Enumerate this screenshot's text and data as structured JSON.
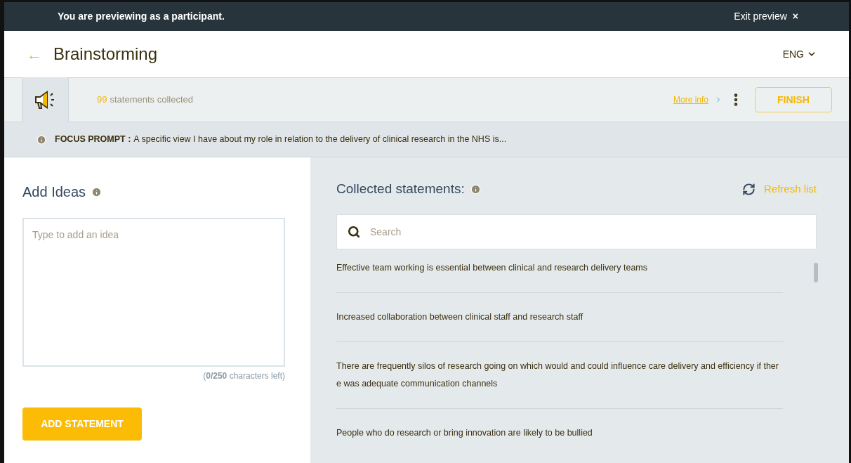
{
  "preview_bar": {
    "message": "You are previewing as a participant.",
    "exit_label": "Exit preview",
    "close_glyph": "×"
  },
  "header": {
    "back_glyph": "←",
    "title": "Brainstorming",
    "language": "ENG"
  },
  "toolbar": {
    "count": "99",
    "count_label": "statements collected",
    "more_info": "More info",
    "finish": "FINISH"
  },
  "focus_prompt": {
    "label": "FOCUS PROMPT :",
    "text": "A specific view I have about my role in relation to the delivery of clinical research in the NHS is..."
  },
  "add_ideas": {
    "title": "Add Ideas",
    "placeholder": "Type to add an idea",
    "counter": "(**0/250** characters left)",
    "button": "ADD STATEMENT"
  },
  "collected": {
    "title": "Collected statements:",
    "refresh": "Refresh list",
    "search_placeholder": "Search",
    "statements": [
      "Effective team working is essential between clinical and research delivery teams",
      "Increased collaboration between clinical staff and research staff",
      "There are frequently silos of research going on which would and could influence care delivery and efficiency if there was adequate communication channels",
      "People who do research or bring innovation are likely to be bullied"
    ]
  }
}
